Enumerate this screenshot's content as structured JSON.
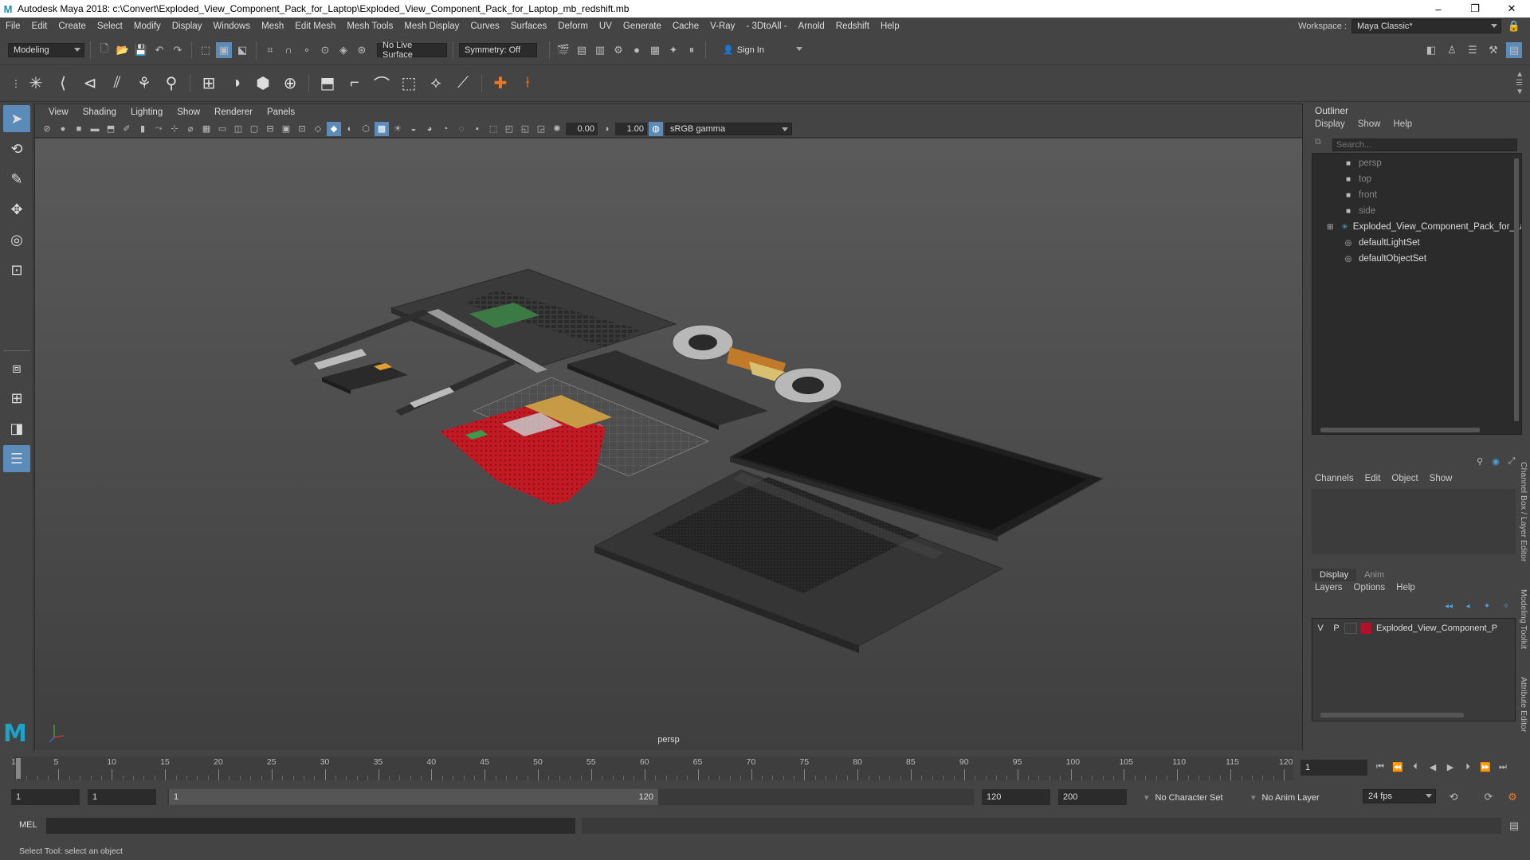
{
  "titlebar": {
    "title": "Autodesk Maya 2018: c:\\Convert\\Exploded_View_Component_Pack_for_Laptop\\Exploded_View_Component_Pack_for_Laptop_mb_redshift.mb",
    "minimize": "–",
    "maximize": "❐",
    "close": "✕"
  },
  "menubar": {
    "items": [
      "File",
      "Edit",
      "Create",
      "Select",
      "Modify",
      "Display",
      "Windows",
      "Mesh",
      "Edit Mesh",
      "Mesh Tools",
      "Mesh Display",
      "Curves",
      "Surfaces",
      "Deform",
      "UV",
      "Generate",
      "Cache",
      "V-Ray",
      "- 3DtoAll -",
      "Arnold",
      "Redshift",
      "Help"
    ],
    "workspace_label": "Workspace :",
    "workspace_value": "Maya Classic*"
  },
  "statusline": {
    "mode": "Modeling",
    "live_surface": "No Live Surface",
    "symmetry": "Symmetry: Off",
    "sign_in": "Sign In"
  },
  "viewport": {
    "menus": [
      "View",
      "Shading",
      "Lighting",
      "Show",
      "Renderer",
      "Panels"
    ],
    "exposure": "0.00",
    "gamma": "1.00",
    "color_space": "sRGB gamma",
    "camera": "persp"
  },
  "outliner": {
    "title": "Outliner",
    "menus": [
      "Display",
      "Show",
      "Help"
    ],
    "search_placeholder": "Search...",
    "items": [
      {
        "label": "persp",
        "kind": "camera"
      },
      {
        "label": "top",
        "kind": "camera"
      },
      {
        "label": "front",
        "kind": "camera"
      },
      {
        "label": "side",
        "kind": "camera"
      },
      {
        "label": "Exploded_View_Component_Pack_for_La",
        "kind": "group"
      },
      {
        "label": "defaultLightSet",
        "kind": "set"
      },
      {
        "label": "defaultObjectSet",
        "kind": "set"
      }
    ]
  },
  "channelbox": {
    "menus": [
      "Channels",
      "Edit",
      "Object",
      "Show"
    ]
  },
  "layereditor": {
    "tabs": [
      "Display",
      "Anim"
    ],
    "menus": [
      "Layers",
      "Options",
      "Help"
    ],
    "layer": {
      "v": "V",
      "p": "P",
      "name": "Exploded_View_Component_P",
      "color": "#b0102a"
    }
  },
  "side_tabs": [
    "Channel Box / Layer Editor",
    "Modeling Toolkit",
    "Attribute Editor"
  ],
  "timeline": {
    "ticks": [
      "1",
      "5",
      "10",
      "15",
      "20",
      "25",
      "30",
      "35",
      "40",
      "45",
      "50",
      "55",
      "60",
      "65",
      "70",
      "75",
      "80",
      "85",
      "90",
      "95",
      "100",
      "105",
      "110",
      "115",
      "120"
    ],
    "current_frame": "1"
  },
  "range": {
    "start": "1",
    "playback_start": "1",
    "slider_start": "1",
    "slider_end": "120",
    "playback_end": "120",
    "end": "200",
    "character_set": "No Character Set",
    "anim_layer": "No Anim Layer",
    "fps": "24 fps"
  },
  "cmdline": {
    "label": "MEL"
  },
  "helpline": {
    "text": "Select Tool: select an object"
  }
}
